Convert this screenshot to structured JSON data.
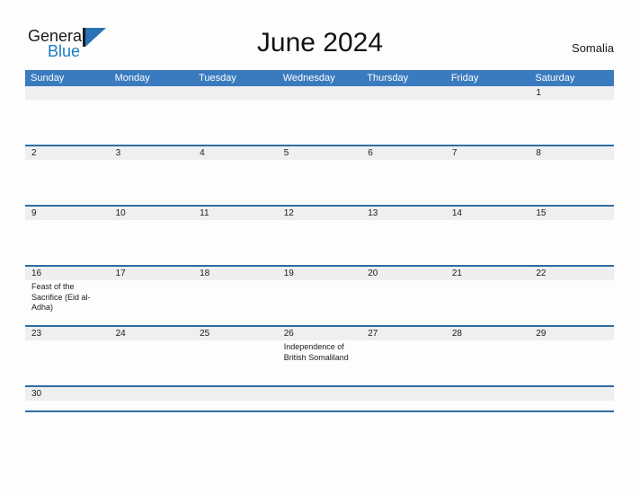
{
  "brand": {
    "word_one": "General",
    "word_two": "Blue",
    "flag_icon": "triangle-flag-icon",
    "accent_blue": "#1a7cc2",
    "flag_blue": "#2872b5"
  },
  "header": {
    "title": "June 2024",
    "country": "Somalia"
  },
  "theme": {
    "header_blue": "#3a7bbf",
    "row_divider_blue": "#2e6da4",
    "band_gray": "#efefef",
    "text_dark": "#1b1b1b"
  },
  "calendar": {
    "weekday_headers": [
      "Sunday",
      "Monday",
      "Tuesday",
      "Wednesday",
      "Thursday",
      "Friday",
      "Saturday"
    ],
    "weeks": [
      {
        "days": [
          {
            "num": "",
            "event": ""
          },
          {
            "num": "",
            "event": ""
          },
          {
            "num": "",
            "event": ""
          },
          {
            "num": "",
            "event": ""
          },
          {
            "num": "",
            "event": ""
          },
          {
            "num": "",
            "event": ""
          },
          {
            "num": "1",
            "event": ""
          }
        ]
      },
      {
        "days": [
          {
            "num": "2",
            "event": ""
          },
          {
            "num": "3",
            "event": ""
          },
          {
            "num": "4",
            "event": ""
          },
          {
            "num": "5",
            "event": ""
          },
          {
            "num": "6",
            "event": ""
          },
          {
            "num": "7",
            "event": ""
          },
          {
            "num": "8",
            "event": ""
          }
        ]
      },
      {
        "days": [
          {
            "num": "9",
            "event": ""
          },
          {
            "num": "10",
            "event": ""
          },
          {
            "num": "11",
            "event": ""
          },
          {
            "num": "12",
            "event": ""
          },
          {
            "num": "13",
            "event": ""
          },
          {
            "num": "14",
            "event": ""
          },
          {
            "num": "15",
            "event": ""
          }
        ]
      },
      {
        "days": [
          {
            "num": "16",
            "event": "Feast of the Sacrifice (Eid al-Adha)"
          },
          {
            "num": "17",
            "event": ""
          },
          {
            "num": "18",
            "event": ""
          },
          {
            "num": "19",
            "event": ""
          },
          {
            "num": "20",
            "event": ""
          },
          {
            "num": "21",
            "event": ""
          },
          {
            "num": "22",
            "event": ""
          }
        ]
      },
      {
        "days": [
          {
            "num": "23",
            "event": ""
          },
          {
            "num": "24",
            "event": ""
          },
          {
            "num": "25",
            "event": ""
          },
          {
            "num": "26",
            "event": "Independence of British Somaliland"
          },
          {
            "num": "27",
            "event": ""
          },
          {
            "num": "28",
            "event": ""
          },
          {
            "num": "29",
            "event": ""
          }
        ]
      },
      {
        "days": [
          {
            "num": "30",
            "event": ""
          },
          {
            "num": "",
            "event": ""
          },
          {
            "num": "",
            "event": ""
          },
          {
            "num": "",
            "event": ""
          },
          {
            "num": "",
            "event": ""
          },
          {
            "num": "",
            "event": ""
          },
          {
            "num": "",
            "event": ""
          }
        ]
      }
    ]
  }
}
